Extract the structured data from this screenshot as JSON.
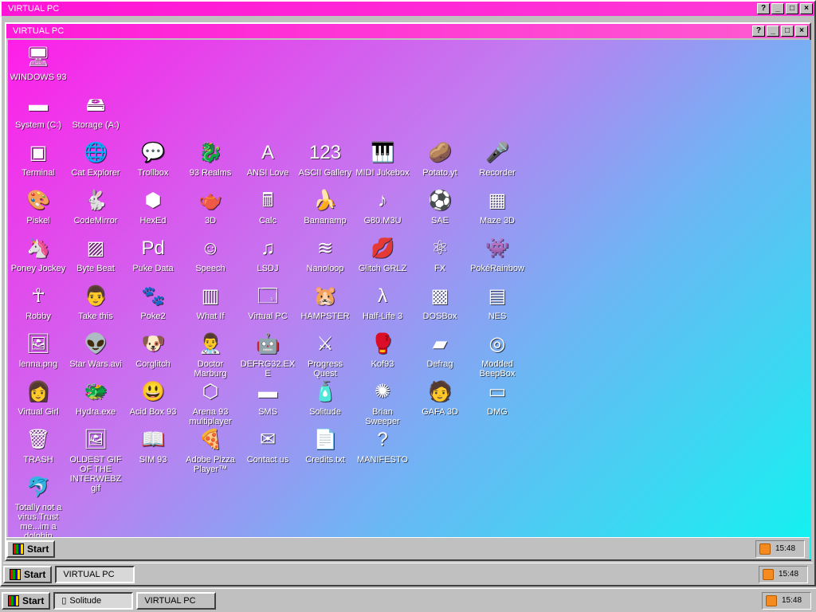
{
  "outer_window": {
    "title": "VIRTUAL PC"
  },
  "inner_window": {
    "title": "VIRTUAL PC"
  },
  "title_buttons": {
    "help": "?",
    "min": "_",
    "max": "□",
    "close": "×"
  },
  "desktop": {
    "icons": [
      {
        "label": "WINDOWS 93",
        "icon": "computer-icon",
        "glyph": "🖥"
      },
      {
        "label": "System (C:)",
        "icon": "drive-icon",
        "glyph": "▬"
      },
      {
        "label": "Storage (A:)",
        "icon": "floppy-drive-icon",
        "glyph": "🖴"
      },
      {
        "label": "Terminal",
        "icon": "terminal-icon",
        "glyph": "▣"
      },
      {
        "label": "Cat Explorer",
        "icon": "globe-icon",
        "glyph": "🌐"
      },
      {
        "label": "Trollbox",
        "icon": "chat-icon",
        "glyph": "💬"
      },
      {
        "label": "93 Realms",
        "icon": "realms-icon",
        "glyph": "🐉"
      },
      {
        "label": "ANSI Love",
        "icon": "ansi-icon",
        "glyph": "A"
      },
      {
        "label": "ASCII Gallery",
        "icon": "ascii-icon",
        "glyph": "123"
      },
      {
        "label": "MIDI Jukebox",
        "icon": "piano-icon",
        "glyph": "🎹"
      },
      {
        "label": "Potato.yt",
        "icon": "potato-icon",
        "glyph": "🥔"
      },
      {
        "label": "Recorder",
        "icon": "microphone-icon",
        "glyph": "🎤"
      },
      {
        "label": "Piskel",
        "icon": "palette-icon",
        "glyph": "🎨"
      },
      {
        "label": "CodeMirror",
        "icon": "codemirror-icon",
        "glyph": "🐇"
      },
      {
        "label": "HexEd",
        "icon": "hexed-icon",
        "glyph": "⬢"
      },
      {
        "label": "3D",
        "icon": "teapot-icon",
        "glyph": "🫖"
      },
      {
        "label": "Calc",
        "icon": "calculator-icon",
        "glyph": "🖩"
      },
      {
        "label": "Bananamp",
        "icon": "banana-icon",
        "glyph": "🍌"
      },
      {
        "label": "G80.M3U",
        "icon": "playlist-icon",
        "glyph": "♪"
      },
      {
        "label": "SAE",
        "icon": "ball-icon",
        "glyph": "⚽"
      },
      {
        "label": "Maze 3D",
        "icon": "maze-icon",
        "glyph": "▦"
      },
      {
        "label": "Poney Jockey",
        "icon": "pony-icon",
        "glyph": "🦄"
      },
      {
        "label": "Byte Beat",
        "icon": "bytebeat-icon",
        "glyph": "▨"
      },
      {
        "label": "Puke Data",
        "icon": "pd-icon",
        "glyph": "Pd"
      },
      {
        "label": "Speech",
        "icon": "face-icon",
        "glyph": "☺"
      },
      {
        "label": "LSDJ",
        "icon": "lsdj-icon",
        "glyph": "♫"
      },
      {
        "label": "Nanoloop",
        "icon": "nanoloop-icon",
        "glyph": "≋"
      },
      {
        "label": "Glitch GRLZ",
        "icon": "lips-icon",
        "glyph": "💋"
      },
      {
        "label": "FX",
        "icon": "atom-icon",
        "glyph": "⚛"
      },
      {
        "label": "PokéRainbow",
        "icon": "pokerainbow-icon",
        "glyph": "👾"
      },
      {
        "label": "Robby",
        "icon": "stickman-icon",
        "glyph": "☥"
      },
      {
        "label": "Take this",
        "icon": "character-icon",
        "glyph": "👨"
      },
      {
        "label": "Poke2",
        "icon": "poke2-icon",
        "glyph": "🐾"
      },
      {
        "label": "What If",
        "icon": "whatif-icon",
        "glyph": "▥"
      },
      {
        "label": "Virtual PC",
        "icon": "virtualpc-icon",
        "glyph": "🗔"
      },
      {
        "label": "HAMPSTER",
        "icon": "hamster-icon",
        "glyph": "🐹"
      },
      {
        "label": "Half-Life 3",
        "icon": "halflife-icon",
        "glyph": "λ"
      },
      {
        "label": "DOSBox",
        "icon": "dosbox-icon",
        "glyph": "▩"
      },
      {
        "label": "NES",
        "icon": "nes-icon",
        "glyph": "▤"
      },
      {
        "label": "lenna.png",
        "icon": "image-file-icon",
        "glyph": "🖼"
      },
      {
        "label": "Star Wars.avi",
        "icon": "yoda-icon",
        "glyph": "👽"
      },
      {
        "label": "Corglitch",
        "icon": "corgi-icon",
        "glyph": "🐶"
      },
      {
        "label": "Doctor Marburg",
        "icon": "doctor-icon",
        "glyph": "👨‍⚕"
      },
      {
        "label": "DEFRG32.EXE",
        "icon": "defrag-exe-icon",
        "glyph": "🤖"
      },
      {
        "label": "Progress Quest",
        "icon": "swords-icon",
        "glyph": "⚔"
      },
      {
        "label": "Kof93",
        "icon": "fighter-icon",
        "glyph": "🥊"
      },
      {
        "label": "Defrag",
        "icon": "defrag-icon",
        "glyph": "▰"
      },
      {
        "label": "Modded BeepBox",
        "icon": "beepbox-icon",
        "glyph": "◎"
      },
      {
        "label": "Virtual Girl",
        "icon": "girl-icon",
        "glyph": "👩"
      },
      {
        "label": "Hydra.exe",
        "icon": "hydra-icon",
        "glyph": "🐲"
      },
      {
        "label": "Acid Box 93",
        "icon": "smiley-icon",
        "glyph": "😃"
      },
      {
        "label": "Arena 93 multiplayer",
        "icon": "cube-icon",
        "glyph": "⬡"
      },
      {
        "label": "SMS",
        "icon": "console-icon",
        "glyph": "▬"
      },
      {
        "label": "Solitude",
        "icon": "bottle-icon",
        "glyph": "🧴"
      },
      {
        "label": "Brian Sweeper",
        "icon": "mine-icon",
        "glyph": "✺"
      },
      {
        "label": "GAFA 3D",
        "icon": "face3d-icon",
        "glyph": "🧑"
      },
      {
        "label": "DMG",
        "icon": "gameboy-icon",
        "glyph": "▭"
      },
      {
        "label": "TRASH",
        "icon": "trash-icon",
        "glyph": "🗑"
      },
      {
        "label": "OLDEST GIF OF THE INTERWEBZ gif",
        "icon": "gif-file-icon",
        "glyph": "🖼"
      },
      {
        "label": "SIM 93",
        "icon": "book-icon",
        "glyph": "📖"
      },
      {
        "label": "Adobe Pizza Player™",
        "icon": "pizza-icon",
        "glyph": "🍕"
      },
      {
        "label": "Contact us",
        "icon": "mail-icon",
        "glyph": "✉"
      },
      {
        "label": "Credits.txt",
        "icon": "text-file-icon",
        "glyph": "📄"
      },
      {
        "label": "MANIFESTO",
        "icon": "question-icon",
        "glyph": "?"
      },
      {
        "label": "Totally not a virus.Trust me...im a dolphin",
        "icon": "dolphin-icon",
        "glyph": "🐬"
      }
    ]
  },
  "taskbar_inner": {
    "start": "Start",
    "time": "15:48"
  },
  "taskbar_outer": {
    "start": "Start",
    "task": "VIRTUAL PC",
    "time": "15:48"
  },
  "taskbar_real": {
    "start": "Start",
    "tasks": [
      "Solitude",
      "VIRTUAL PC"
    ],
    "time": "15:48"
  }
}
